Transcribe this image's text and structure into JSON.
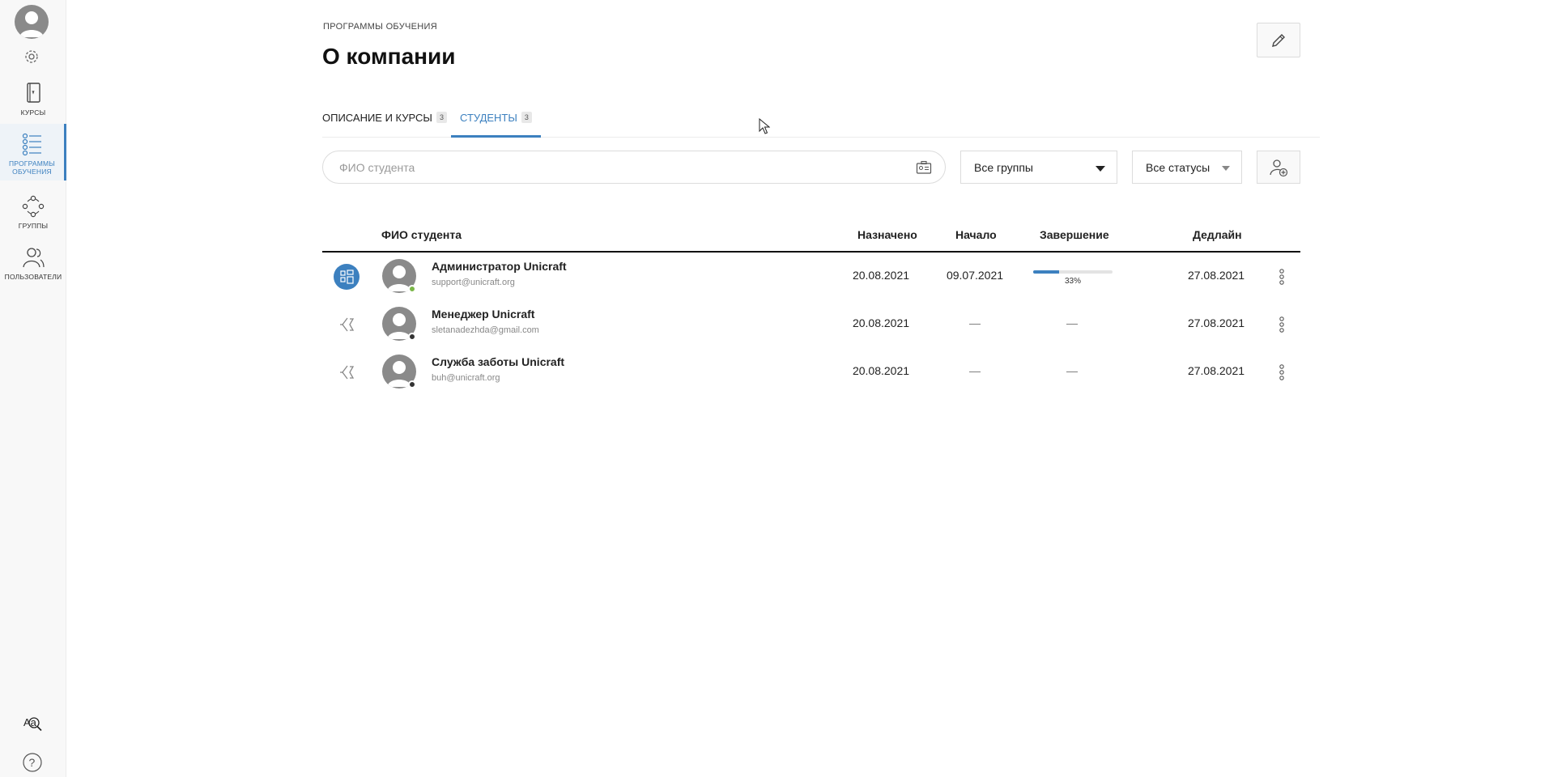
{
  "sidebar": {
    "items": [
      {
        "label": "КУРСЫ"
      },
      {
        "label": "ПРОГРАММЫ ОБУЧЕНИЯ"
      },
      {
        "label": "ГРУППЫ"
      },
      {
        "label": "ПОЛЬЗОВАТЕЛИ"
      }
    ],
    "active_index": 1
  },
  "header": {
    "breadcrumb": "ПРОГРАММЫ ОБУЧЕНИЯ",
    "title": "О компании"
  },
  "tabs": [
    {
      "label": "ОПИСАНИЕ И КУРСЫ",
      "count": "3"
    },
    {
      "label": "СТУДЕНТЫ",
      "count": "3"
    }
  ],
  "filters": {
    "search_placeholder": "ФИО студента",
    "groups_value": "Все группы",
    "status_value": "Все статусы"
  },
  "table": {
    "headers": {
      "name": "ФИО студента",
      "assigned": "Назначено",
      "start": "Начало",
      "end": "Завершение",
      "deadline": "Дедлайн"
    },
    "rows": [
      {
        "name": "Администратор Unicraft",
        "email": "support@unicraft.org",
        "assigned": "20.08.2021",
        "start": "09.07.2021",
        "end": "",
        "progress_percent": 33,
        "progress_label": "33%",
        "deadline": "27.08.2021",
        "status_icon": "in-progress-icon",
        "presence": "online"
      },
      {
        "name": "Менеджер Unicraft",
        "email": "sletanadezhda@gmail.com",
        "assigned": "20.08.2021",
        "start": "—",
        "end": "—",
        "progress_percent": null,
        "progress_label": "",
        "deadline": "27.08.2021",
        "status_icon": "not-started-icon",
        "presence": "offline"
      },
      {
        "name": "Служба заботы Unicraft",
        "email": "buh@unicraft.org",
        "assigned": "20.08.2021",
        "start": "—",
        "end": "—",
        "progress_percent": null,
        "progress_label": "",
        "deadline": "27.08.2021",
        "status_icon": "not-started-icon",
        "presence": "offline"
      }
    ]
  },
  "colors": {
    "accent": "#3c80bf",
    "online": "#7ab648",
    "offline": "#333333"
  }
}
